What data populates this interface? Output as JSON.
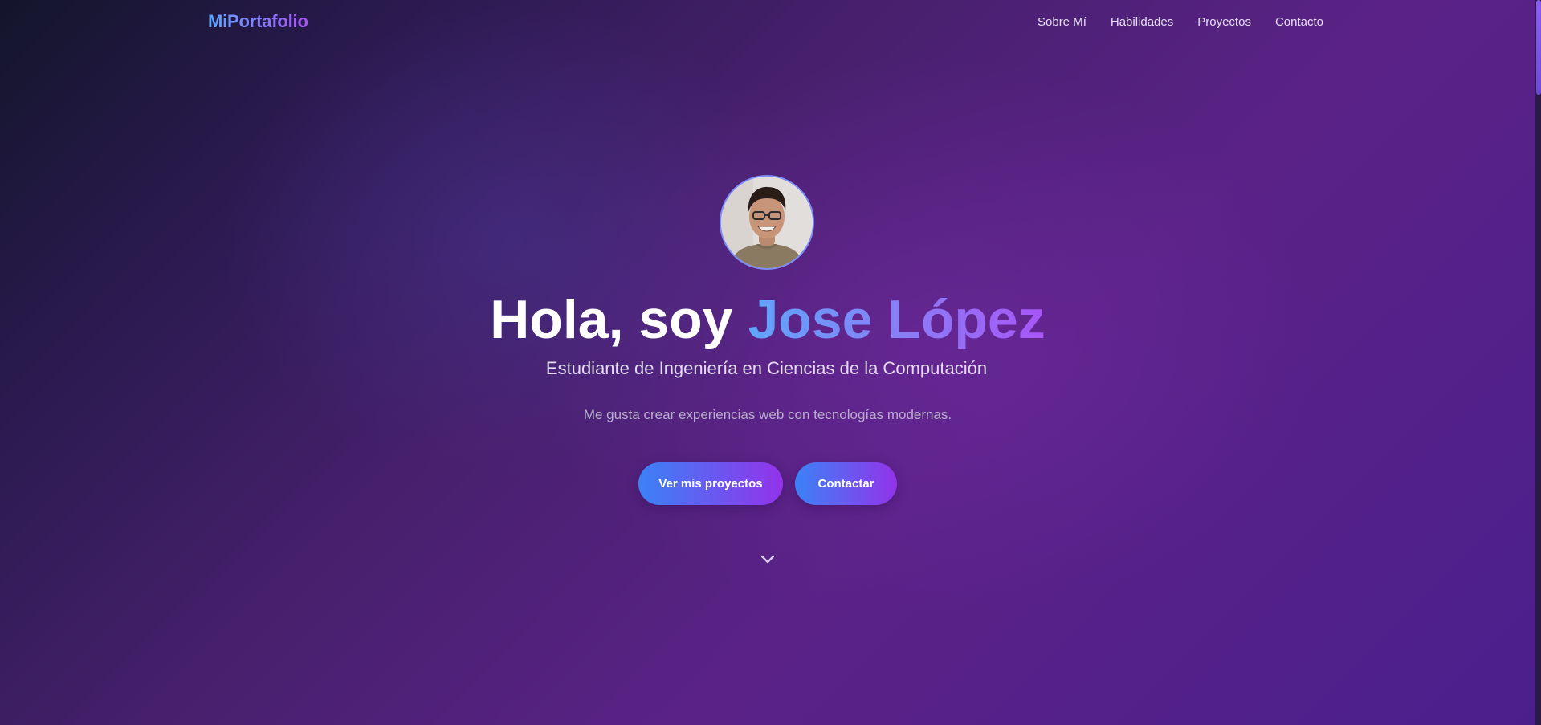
{
  "header": {
    "brand": "MiPortafolio",
    "nav": [
      {
        "label": "Sobre Mí"
      },
      {
        "label": "Habilidades"
      },
      {
        "label": "Proyectos"
      },
      {
        "label": "Contacto"
      }
    ]
  },
  "hero": {
    "greeting": "Hola, soy ",
    "name": "Jose López",
    "subtitle": "Estudiante de Ingeniería en Ciencias de la Computación",
    "tagline": "Me gusta crear experiencias web con tecnologías modernas.",
    "buttons": {
      "projects": "Ver mis proyectos",
      "contact": "Contactar"
    },
    "scroll_icon": "chevron-down-icon"
  },
  "colors": {
    "accent_start": "#3b82f6",
    "accent_end": "#9333ea",
    "background": "#54208a"
  }
}
